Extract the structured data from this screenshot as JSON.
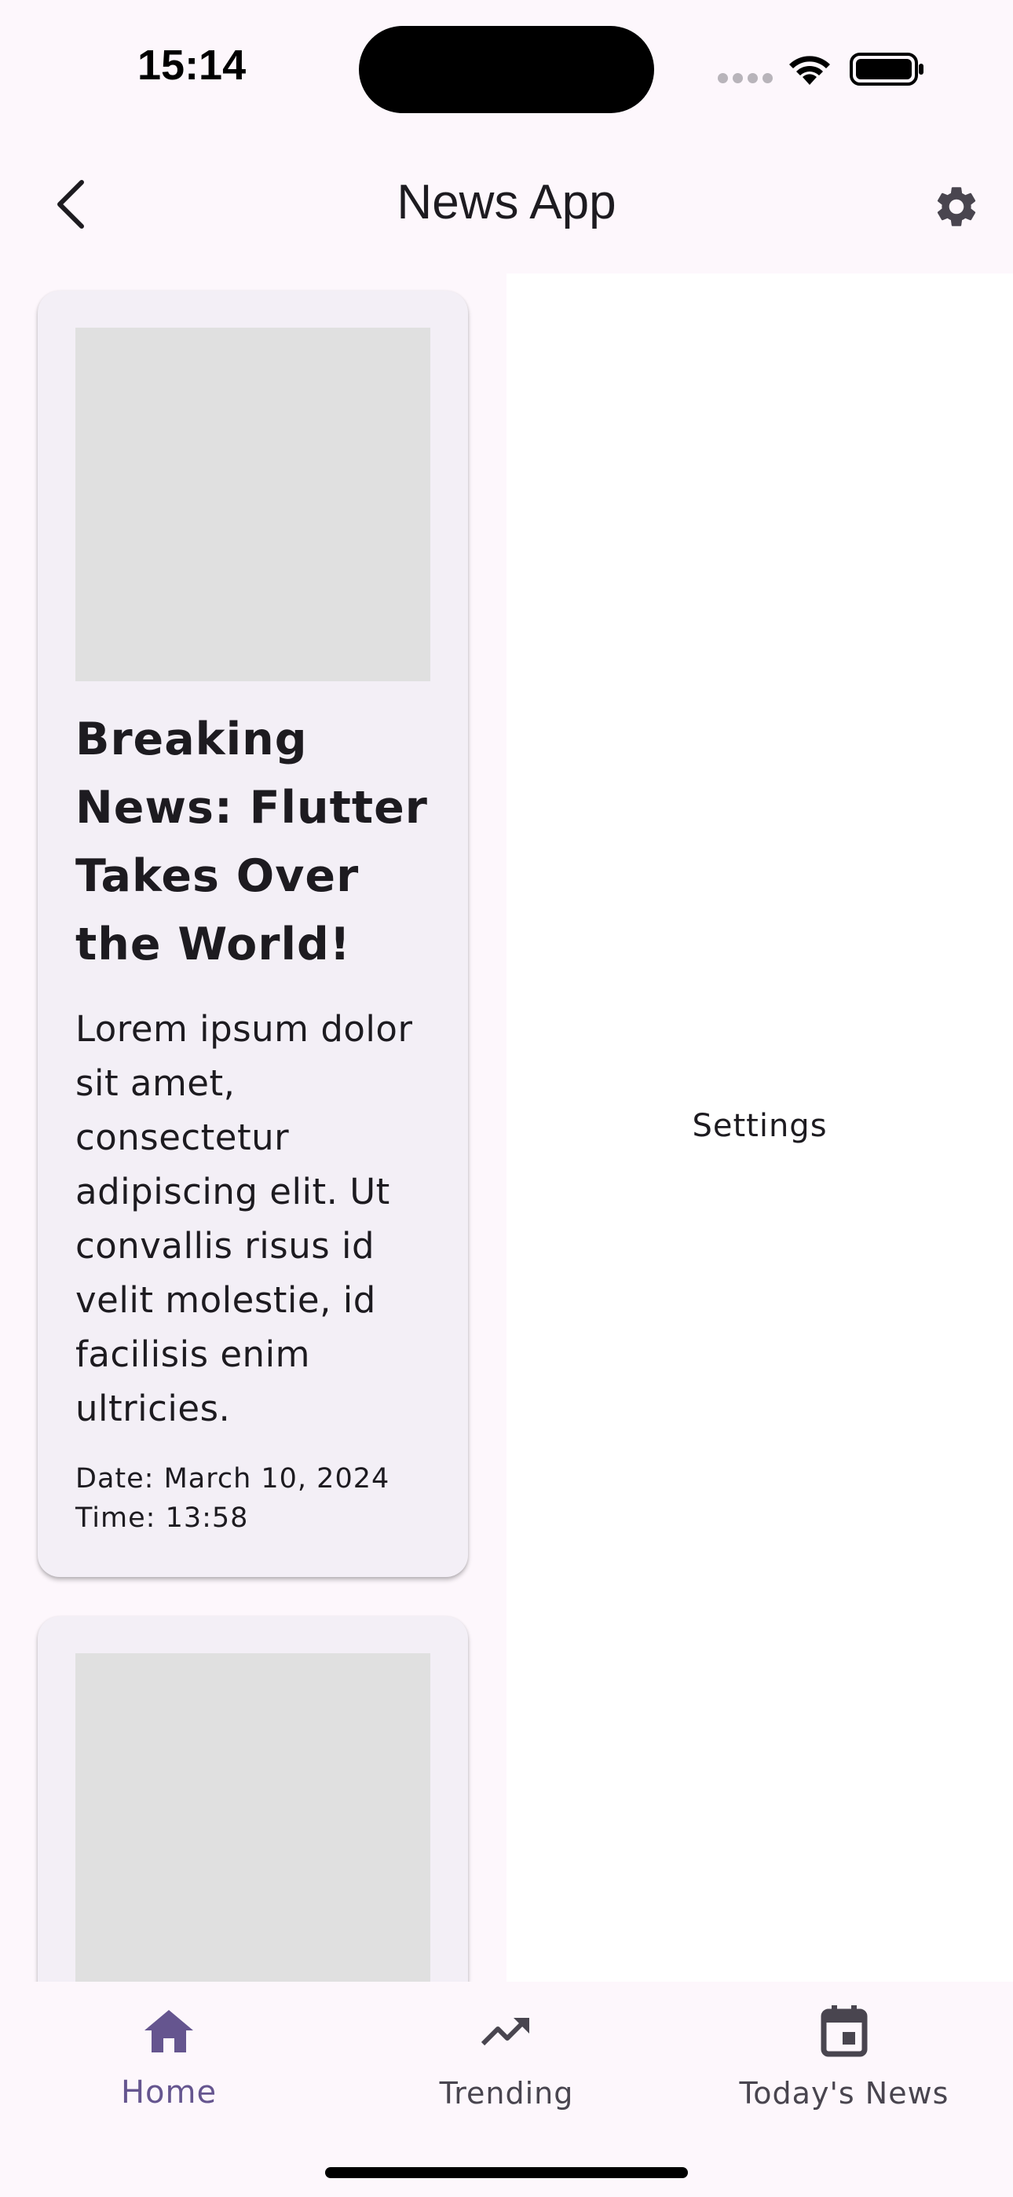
{
  "status_bar": {
    "time": "15:14"
  },
  "app_bar": {
    "title": "News App",
    "back_icon": "chevron-left-icon",
    "settings_icon": "gear-icon"
  },
  "right_pane": {
    "label": "Settings"
  },
  "cards": [
    {
      "title": "Breaking News: Flutter Takes Over the World!",
      "body": "Lorem ipsum dolor sit amet, consectetur adipiscing elit. Ut convallis risus id velit molestie, id facilisis enim ultricies.",
      "date": "Date: March 10, 2024",
      "time": "Time: 13:58"
    }
  ],
  "bottom_nav": {
    "items": [
      {
        "label": "Home",
        "icon": "home-icon",
        "selected": true
      },
      {
        "label": "Trending",
        "icon": "trending-up-icon",
        "selected": false
      },
      {
        "label": "Today's News",
        "icon": "calendar-icon",
        "selected": false
      }
    ]
  },
  "colors": {
    "background": "#fdf7fc",
    "card": "#f3eff6",
    "image_placeholder": "#e0e0e0",
    "accent": "#65558f",
    "icon": "#49454f"
  }
}
